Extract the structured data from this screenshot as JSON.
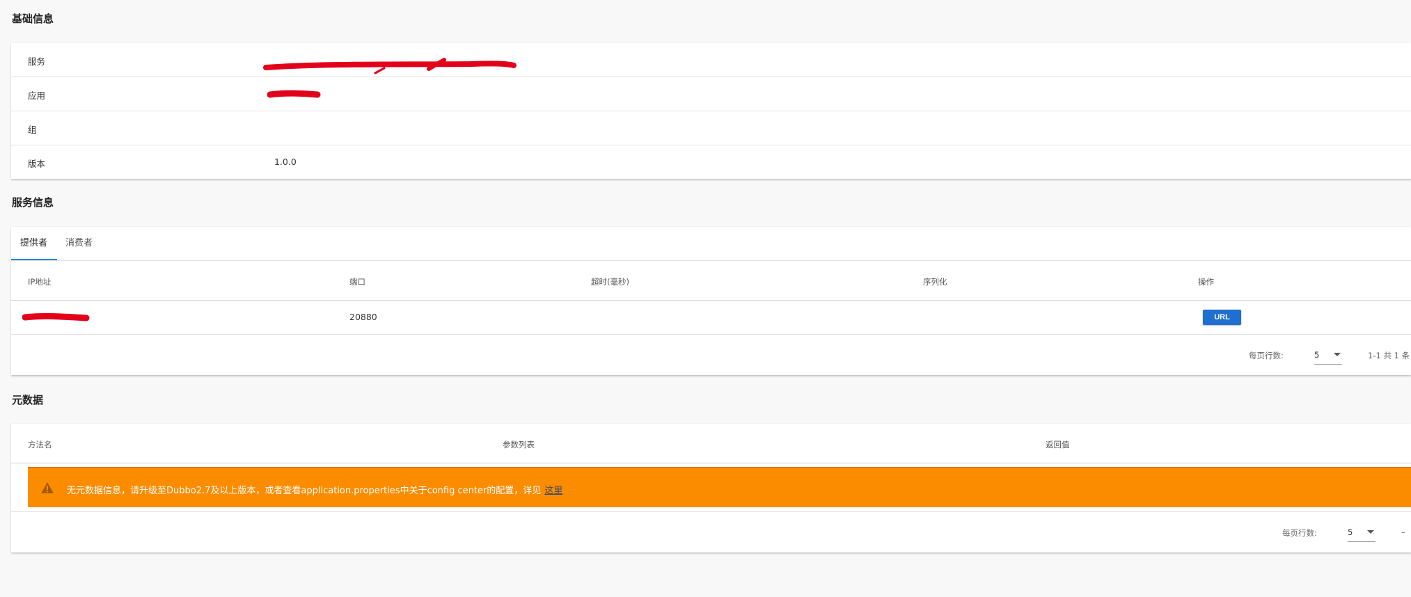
{
  "basic_info": {
    "title": "基础信息",
    "rows": [
      {
        "label": "服务",
        "value": ""
      },
      {
        "label": "应用",
        "value": ""
      },
      {
        "label": "组",
        "value": ""
      },
      {
        "label": "版本",
        "value": "1.0.0"
      }
    ]
  },
  "service_info": {
    "title": "服务信息",
    "tabs": [
      "提供者",
      "消费者"
    ],
    "columns": [
      "IP地址",
      "端口",
      "超时(毫秒)",
      "序列化",
      "操作"
    ],
    "rows": [
      {
        "ip": "",
        "port": "20880",
        "timeout": "",
        "serialization": "",
        "action": "URL"
      }
    ],
    "pager": {
      "rows_per_page_label": "每页行数:",
      "rows_per_page": "5",
      "range": "1-1 共 1 条"
    }
  },
  "metadata": {
    "title": "元数据",
    "columns": [
      "方法名",
      "参数列表",
      "返回值"
    ],
    "alert": {
      "text": "无元数据信息，请升级至Dubbo2.7及以上版本，或者查看application.properties中关于config center的配置，详见",
      "link": "这里"
    },
    "pager": {
      "rows_per_page_label": "每页行数:",
      "rows_per_page": "5",
      "range": "–"
    }
  },
  "colors": {
    "accent": "#1e88e5",
    "button": "#1e6fd0",
    "warning": "#fb8c00",
    "redaction": "#e3001b"
  },
  "icons": {
    "alert": "warning-icon",
    "select": "chevron-down-icon"
  }
}
